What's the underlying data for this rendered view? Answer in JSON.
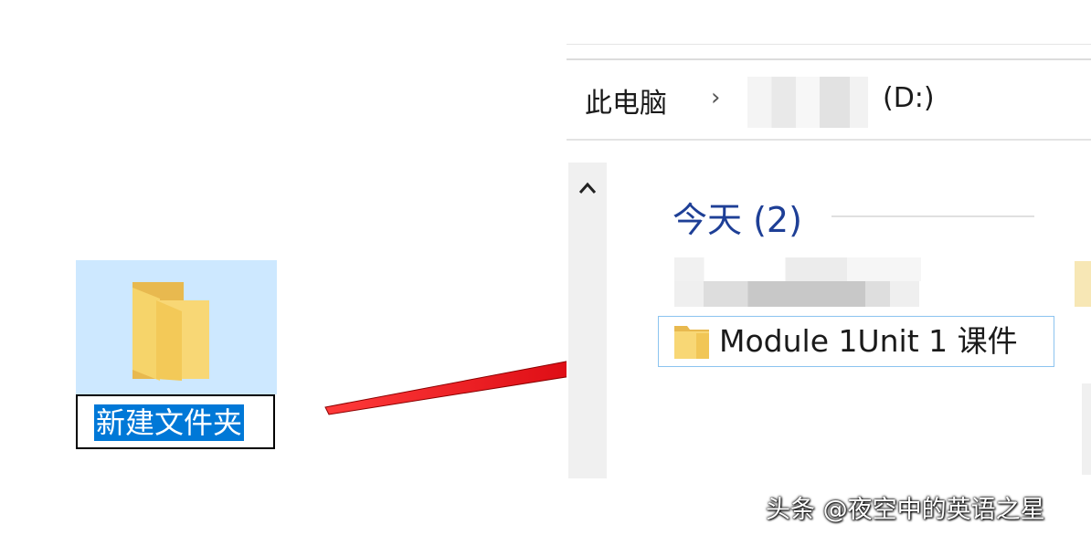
{
  "desktop": {
    "rename_value": "新建文件夹"
  },
  "explorer": {
    "breadcrumb_root": "此电脑",
    "breadcrumb_separator": "›",
    "breadcrumb_drive": "(D:)",
    "group_header": "今天 (2)",
    "file_name": "Module 1Unit 1 课件"
  },
  "watermark": "头条 @夜空中的英语之星",
  "colors": {
    "selection_bg": "#cde8ff",
    "rename_highlight": "#0078d7",
    "group_header": "#1e3f96",
    "arrow": "#e0141c",
    "folder": "#f8d775"
  },
  "icons": {
    "folder": "folder-icon",
    "scroll_up": "chevron-up-icon",
    "arrow": "red-arrow-annotation"
  }
}
